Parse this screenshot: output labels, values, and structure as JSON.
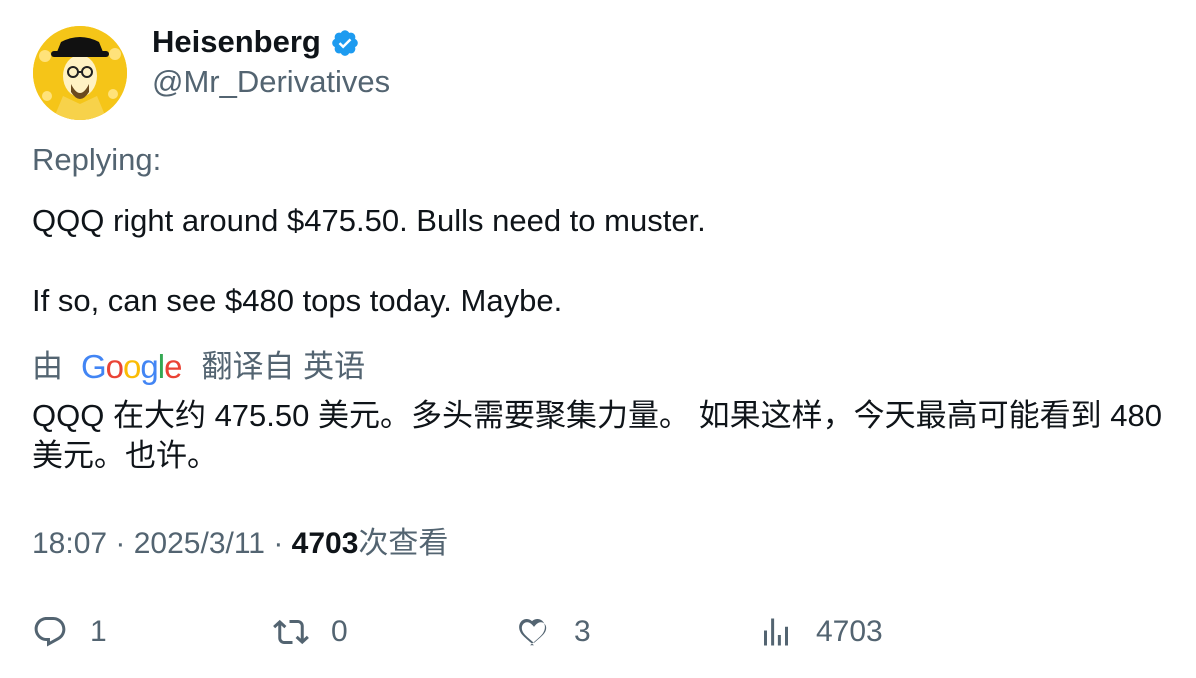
{
  "author": {
    "display_name": "Heisenberg",
    "handle": "@Mr_Derivatives",
    "verified": true,
    "avatar_icon": "avatar-heisenberg"
  },
  "replying_label": "Replying:",
  "tweet": {
    "line1": "QQQ right around $475.50. Bulls need to muster.",
    "line2": "If so, can see $480 tops today. Maybe."
  },
  "translation": {
    "by_label": "由",
    "provider": "Google",
    "label": "翻译自 英语",
    "text": "QQQ 在大约 475.50 美元。多头需要聚集力量。 如果这样，今天最高可能看到 480 美元。也许。"
  },
  "meta": {
    "time": "18:07",
    "date": "2025/3/11",
    "views": "4703",
    "views_label": "次查看",
    "separator": "·"
  },
  "actions": {
    "replies": "1",
    "retweets": "0",
    "likes": "3",
    "views": "4703"
  },
  "colors": {
    "text": "#0f1419",
    "muted": "#536471",
    "verified": "#1d9bf0",
    "avatar_bg": "#f5c518"
  }
}
